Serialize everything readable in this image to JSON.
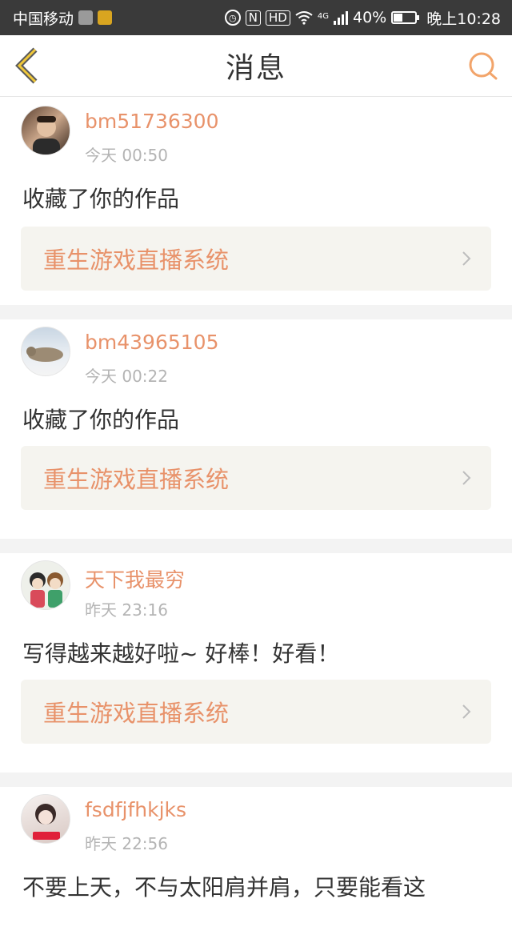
{
  "status_bar": {
    "carrier": "中国移动",
    "network": "4G",
    "battery": "40%",
    "time": "晚上10:28",
    "icons": [
      "shield-icon",
      "app-icon",
      "alarm-icon",
      "nfc-icon",
      "hd-icon",
      "wifi-icon",
      "signal-icon",
      "battery-icon"
    ]
  },
  "header": {
    "title": "消息",
    "back_icon": "chevron-left-icon",
    "search_icon": "search-icon"
  },
  "colors": {
    "accent": "#e8926a",
    "text": "#333333",
    "muted": "#b4b4b4",
    "card_bg": "#f5f4ef",
    "separator": "#f3f3f3"
  },
  "messages": [
    {
      "username": "bm51736300",
      "time": "今天 00:50",
      "text": "收藏了你的作品",
      "work_title": "重生游戏直播系统"
    },
    {
      "username": "bm43965105",
      "time": "今天 00:22",
      "text": "收藏了你的作品",
      "work_title": "重生游戏直播系统"
    },
    {
      "username": "天下我最穷",
      "time": "昨天 23:16",
      "text": "写得越来越好啦~ 好棒！好看！",
      "work_title": "重生游戏直播系统"
    },
    {
      "username": "fsdfjfhkjks",
      "time": "昨天 22:56",
      "text": "不要上天，不与太阳肩并肩，只要能看这"
    }
  ]
}
